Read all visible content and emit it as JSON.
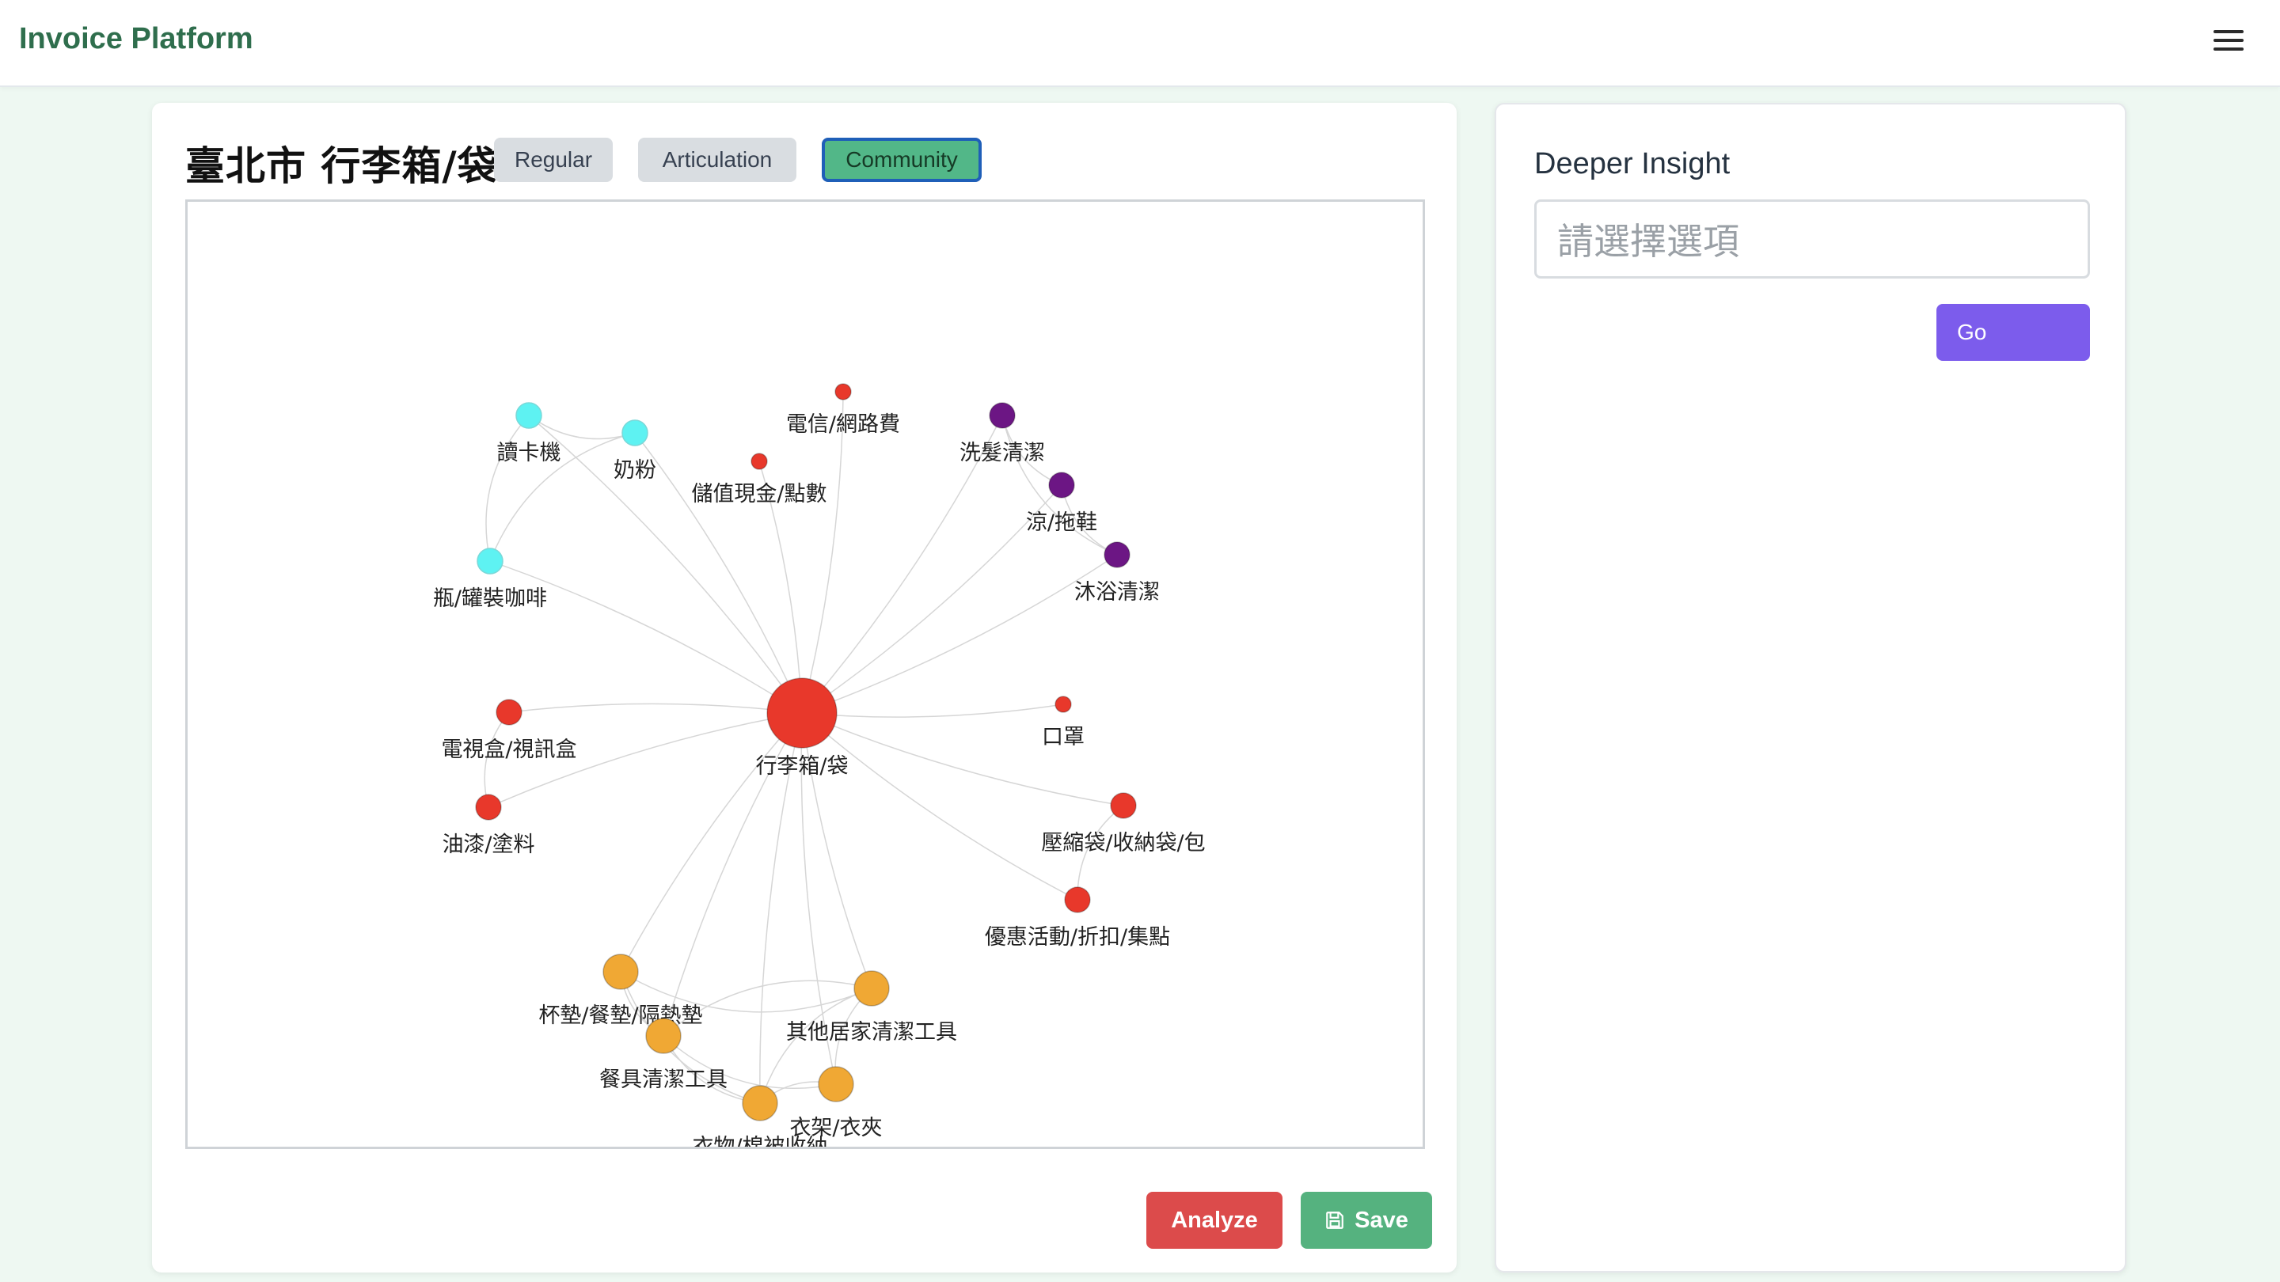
{
  "app": {
    "brand": "Invoice Platform"
  },
  "header": {
    "menu_icon": "hamburger-menu-icon"
  },
  "main": {
    "title": "臺北市 行李箱/袋",
    "tabs": [
      {
        "label": "Regular",
        "active": false
      },
      {
        "label": "Articulation",
        "active": false
      },
      {
        "label": "Community",
        "active": true
      }
    ],
    "buttons": {
      "analyze": "Analyze",
      "save": "Save"
    }
  },
  "insight": {
    "title": "Deeper Insight",
    "select_placeholder": "請選擇選項",
    "go": "Go"
  },
  "colors": {
    "red": "#e8382b",
    "cyan": "#5ef2f2",
    "purple": "#6c1684",
    "orange": "#f0a834",
    "active_tab": "#52b788",
    "go_button": "#7c5cec",
    "analyze_button": "#dc4b4b",
    "save_button": "#55b27f"
  },
  "graph": {
    "center": "行李箱/袋",
    "nodes": [
      {
        "id": "n0",
        "label": "行李箱/袋",
        "community": "red",
        "size": "large"
      },
      {
        "id": "n1",
        "label": "讀卡機",
        "community": "cyan",
        "size": "medium"
      },
      {
        "id": "n2",
        "label": "奶粉",
        "community": "cyan",
        "size": "medium"
      },
      {
        "id": "n3",
        "label": "瓶/罐裝咖啡",
        "community": "cyan",
        "size": "medium"
      },
      {
        "id": "n4",
        "label": "電信/網路費",
        "community": "red",
        "size": "small"
      },
      {
        "id": "n5",
        "label": "儲值現金/點數",
        "community": "red",
        "size": "small"
      },
      {
        "id": "n6",
        "label": "洗髮清潔",
        "community": "purple",
        "size": "medium"
      },
      {
        "id": "n7",
        "label": "涼/拖鞋",
        "community": "purple",
        "size": "medium"
      },
      {
        "id": "n8",
        "label": "沐浴清潔",
        "community": "purple",
        "size": "medium"
      },
      {
        "id": "n9",
        "label": "電視盒/視訊盒",
        "community": "red",
        "size": "medium"
      },
      {
        "id": "n10",
        "label": "油漆/塗料",
        "community": "red",
        "size": "medium"
      },
      {
        "id": "n11",
        "label": "口罩",
        "community": "red",
        "size": "small"
      },
      {
        "id": "n12",
        "label": "壓縮袋/收納袋/包",
        "community": "red",
        "size": "medium"
      },
      {
        "id": "n13",
        "label": "優惠活動/折扣/集點",
        "community": "red",
        "size": "medium"
      },
      {
        "id": "n14",
        "label": "杯墊/餐墊/隔熱墊",
        "community": "orange",
        "size": "large"
      },
      {
        "id": "n15",
        "label": "其他居家清潔工具",
        "community": "orange",
        "size": "large"
      },
      {
        "id": "n16",
        "label": "餐具清潔工具",
        "community": "orange",
        "size": "large"
      },
      {
        "id": "n17",
        "label": "衣架/衣夾",
        "community": "orange",
        "size": "large"
      },
      {
        "id": "n18",
        "label": "衣物/棉被收納",
        "community": "orange",
        "size": "large"
      }
    ],
    "edges": [
      [
        "n0",
        "n1"
      ],
      [
        "n0",
        "n2"
      ],
      [
        "n0",
        "n3"
      ],
      [
        "n0",
        "n4"
      ],
      [
        "n0",
        "n5"
      ],
      [
        "n0",
        "n6"
      ],
      [
        "n0",
        "n7"
      ],
      [
        "n0",
        "n8"
      ],
      [
        "n0",
        "n9"
      ],
      [
        "n0",
        "n10"
      ],
      [
        "n0",
        "n11"
      ],
      [
        "n0",
        "n12"
      ],
      [
        "n0",
        "n13"
      ],
      [
        "n0",
        "n14"
      ],
      [
        "n0",
        "n15"
      ],
      [
        "n0",
        "n16"
      ],
      [
        "n0",
        "n17"
      ],
      [
        "n0",
        "n18"
      ],
      [
        "n1",
        "n2"
      ],
      [
        "n1",
        "n3"
      ],
      [
        "n2",
        "n3"
      ],
      [
        "n6",
        "n7"
      ],
      [
        "n7",
        "n8"
      ],
      [
        "n6",
        "n8"
      ],
      [
        "n9",
        "n10"
      ],
      [
        "n12",
        "n13"
      ],
      [
        "n14",
        "n15"
      ],
      [
        "n14",
        "n16"
      ],
      [
        "n14",
        "n18"
      ],
      [
        "n15",
        "n16"
      ],
      [
        "n15",
        "n17"
      ],
      [
        "n16",
        "n18"
      ],
      [
        "n16",
        "n17"
      ],
      [
        "n17",
        "n18"
      ],
      [
        "n15",
        "n18"
      ]
    ]
  }
}
